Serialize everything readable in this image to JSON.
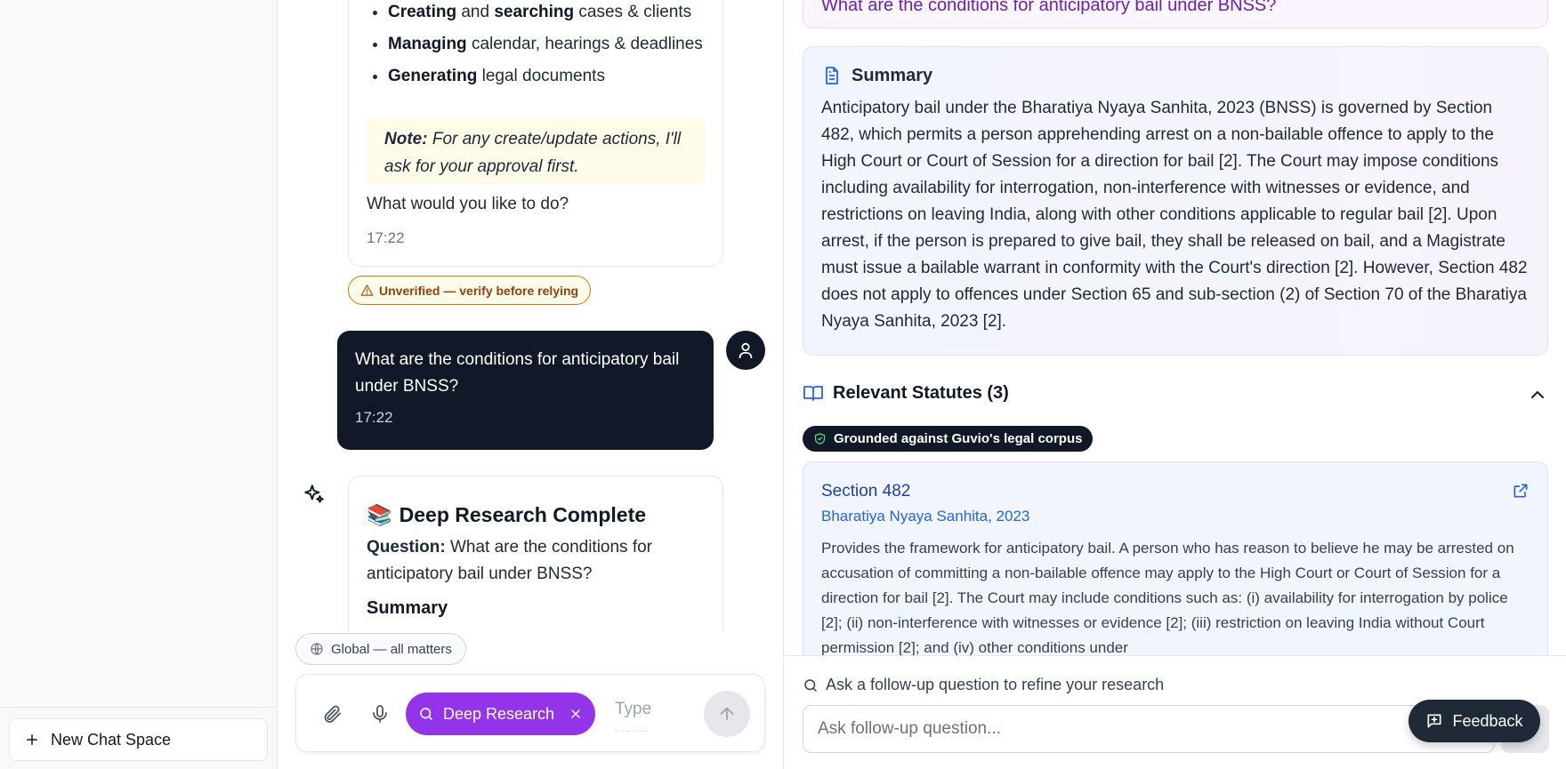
{
  "sidebar": {
    "new_chat_label": "New Chat Space"
  },
  "chat": {
    "bot_message": {
      "items": [
        {
          "bold": "Creating",
          "mid": " and ",
          "bold2": "searching",
          "rest": " cases & clients"
        },
        {
          "bold": "Managing",
          "rest": " calendar, hearings & deadlines"
        },
        {
          "bold": "Generating",
          "rest": " legal documents"
        }
      ],
      "note_label": "Note:",
      "note_text": " For any create/update actions, I'll ask for your approval first.",
      "question": "What would you like to do?",
      "time": "17:22"
    },
    "warning_badge": "Unverified — verify before relying",
    "user_message": {
      "text": "What are the conditions for anticipatory bail under BNSS?",
      "time": "17:22"
    },
    "research_card": {
      "emoji": "📚",
      "title": "Deep Research Complete",
      "question_label": "Question:",
      "question_text": " What are the conditions for anticipatory bail under BNSS?",
      "summary_label": "Summary"
    },
    "scope_pill": "Global — all matters",
    "composer": {
      "deep_research_label": "Deep Research",
      "placeholder": "Type your"
    }
  },
  "panel": {
    "question": "What are the conditions for anticipatory bail under BNSS?",
    "summary": {
      "heading": "Summary",
      "text": "Anticipatory bail under the Bharatiya Nyaya Sanhita, 2023 (BNSS) is governed by Section 482, which permits a person apprehending arrest on a non-bailable offence to apply to the High Court or Court of Session for a direction for bail [2]. The Court may impose conditions including availability for interrogation, non-interference with witnesses or evidence, and restrictions on leaving India, along with other conditions applicable to regular bail [2]. Upon arrest, if the person is prepared to give bail, they shall be released on bail, and a Magistrate must issue a bailable warrant in conformity with the Court's direction [2]. However, Section 482 does not apply to offences under Section 65 and sub-section (2) of Section 70 of the Bharatiya Nyaya Sanhita, 2023 [2]."
    },
    "statutes": {
      "heading": "Relevant Statutes (3)",
      "grounded_badge": "Grounded against Guvio's legal corpus",
      "items": [
        {
          "title": "Section 482",
          "act": "Bharatiya Nyaya Sanhita, 2023",
          "description": "Provides the framework for anticipatory bail. A person who has reason to believe he may be arrested on accusation of committing a non-bailable offence may apply to the High Court or Court of Session for a direction for bail [2]. The Court may include conditions such as: (i) availability for interrogation by police [2]; (ii) non-interference with witnesses or evidence [2]; (iii) restriction on leaving India without Court permission [2]; and (iv) other conditions under"
        }
      ]
    },
    "followup": {
      "hint": "Ask a follow-up question to refine your research",
      "placeholder": "Ask follow-up question..."
    },
    "feedback_label": "Feedback"
  },
  "colors": {
    "accent_purple": "#9333ea",
    "dark": "#111827",
    "link_blue": "#1e40af",
    "warning": "#d97706"
  }
}
